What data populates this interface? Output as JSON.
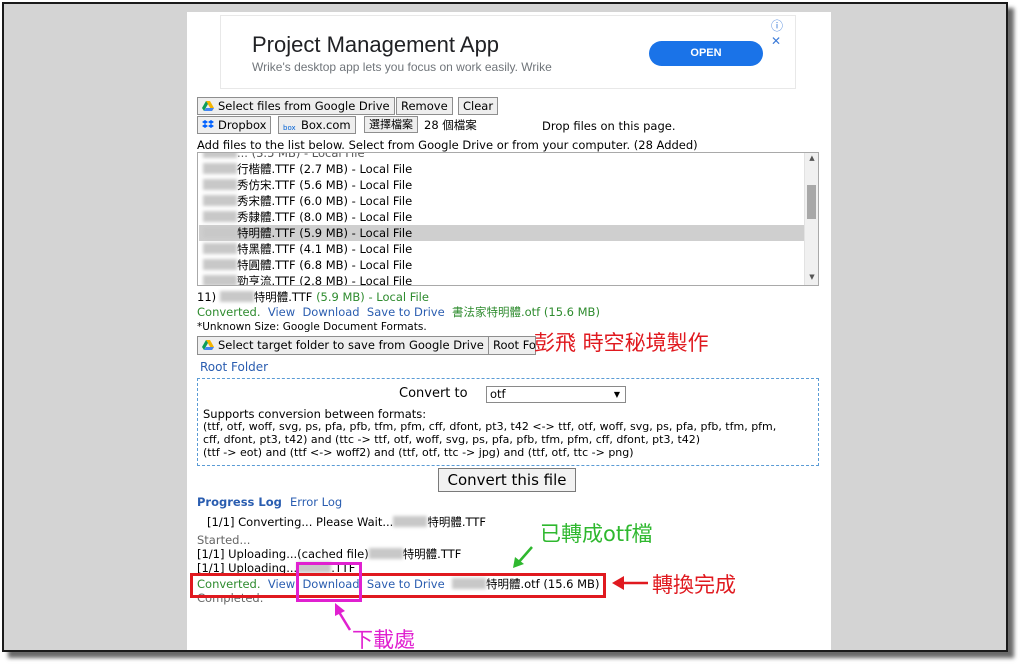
{
  "ad": {
    "title": "Project Management App",
    "subtitle": "Wrike's desktop app lets you focus on work easily. Wrike",
    "cta": "OPEN",
    "controls": "ⓘ ✕"
  },
  "toolbar": {
    "google_drive_label": "Select files from Google Drive",
    "remove_label": "Remove",
    "clear_label": "Clear",
    "dropbox_label": "Dropbox",
    "box_label": "Box.com",
    "choose_file_label": "選擇檔案",
    "file_count": "28 個檔案",
    "drop_hint": "Drop files on this page."
  },
  "instructions": "Add files to the list below. Select from Google Drive or from your computer. (28 Added)",
  "file_list": [
    {
      "name": "行楷體.TTF (2.7 MB) - Local File",
      "selected": false
    },
    {
      "name": "秀仿宋.TTF (5.6 MB) - Local File",
      "selected": false
    },
    {
      "name": "秀宋體.TTF (6.0 MB) - Local File",
      "selected": false
    },
    {
      "name": "秀隸體.TTF (8.0 MB) - Local File",
      "selected": false
    },
    {
      "name": "特明體.TTF (5.9 MB) - Local File",
      "selected": true
    },
    {
      "name": "特黑體.TTF (4.1 MB) - Local File",
      "selected": false
    },
    {
      "name": "特圓體.TTF (6.8 MB) - Local File",
      "selected": false
    },
    {
      "name": "勁亨流.TTF (2.8 MB) - Local File",
      "selected": false
    }
  ],
  "selected_file": {
    "index": "11)",
    "name": "特明體.TTF",
    "size": "(5.9 MB) - Local File"
  },
  "result": {
    "status": "Converted.",
    "view": "View",
    "download": "Download",
    "save_to_drive": "Save to Drive",
    "output_name": "書法家特明體.otf (15.6 MB)"
  },
  "unknown_size_note": "*Unknown Size: Google Document Formats.",
  "target_folder_label": "Select target folder to save from Google Drive",
  "root_folder_button": "Root Fo",
  "root_folder_link": "Root Folder",
  "convert": {
    "label": "Convert to",
    "selected_format": "otf",
    "supports_title": "Supports conversion between formats:",
    "formats_line1": "(ttf, otf, woff, svg, ps, pfa, pfb, tfm, pfm, cff, dfont, pt3, t42 <-> ttf, otf, woff, svg, ps, pfa, pfb, tfm, pfm,",
    "formats_line2": "cff, dfont, pt3, t42) and (ttc -> ttf, otf, woff, svg, ps, pfa, pfb, tfm, pfm, cff, dfont, pt3, t42)",
    "formats_line3": "(ttf -> eot) and (ttf <-> woff2) and (ttf, otf, ttc -> jpg) and (ttf, otf, ttc -> png)",
    "button": "Convert this file"
  },
  "log": {
    "progress_tab": "Progress Log",
    "error_tab": "Error Log",
    "converting": "[1/1] Converting... Please Wait...",
    "converting_file": "特明體.TTF",
    "started": "Started...",
    "uploading1": "[1/1] Uploading...(cached file)",
    "uploading1_file": "特明體.TTF",
    "uploading2": "[1/1] Uploading...",
    "uploading2_file": ".TTF",
    "converted": "Converted.",
    "view": "View",
    "download": "Download",
    "save_to_drive": "Save to Drive",
    "output": "特明體.otf (15.6 MB)",
    "completed": "Completed."
  },
  "annotations": {
    "credit": "彭飛 時空秘境製作",
    "converted_note": "已轉成otf檔",
    "done_note": "轉換完成",
    "download_note": "下載處",
    "colors": {
      "red": "#e0191f",
      "green": "#2fb82f",
      "magenta": "#e020d0"
    }
  }
}
